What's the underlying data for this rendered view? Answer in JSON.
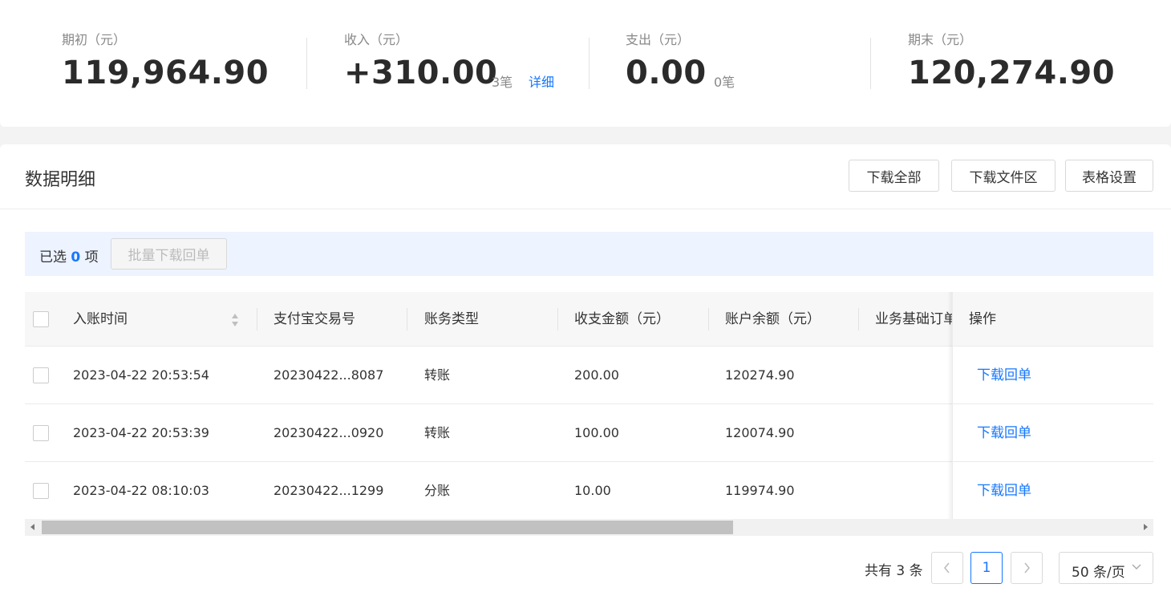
{
  "summary": {
    "opening": {
      "label": "期初（元）",
      "value": "119,964.90"
    },
    "income": {
      "label": "收入（元）",
      "value": "+310.00",
      "count": "3笔",
      "detail": "详细"
    },
    "expense": {
      "label": "支出（元）",
      "value": "0.00",
      "count": "0笔"
    },
    "closing": {
      "label": "期末（元）",
      "value": "120,274.90"
    }
  },
  "detail": {
    "title": "数据明细",
    "buttons": {
      "download_all": "下载全部",
      "download_files": "下载文件区",
      "table_settings": "表格设置"
    },
    "selection": {
      "prefix": "已选",
      "count": "0",
      "suffix": "项",
      "batch_button": "批量下载回单"
    }
  },
  "table": {
    "headers": {
      "time": "入账时间",
      "trade_no": "支付宝交易号",
      "type": "账务类型",
      "amount": "收支金额（元）",
      "balance": "账户余额（元）",
      "biz_order": "业务基础订单号",
      "ops": "操作"
    },
    "rows": [
      {
        "time": "2023-04-22 20:53:54",
        "trade_no": "20230422...8087",
        "type": "转账",
        "amount": "200.00",
        "balance": "120274.90",
        "op": "下载回单"
      },
      {
        "time": "2023-04-22 20:53:39",
        "trade_no": "20230422...0920",
        "type": "转账",
        "amount": "100.00",
        "balance": "120074.90",
        "op": "下载回单"
      },
      {
        "time": "2023-04-22 08:10:03",
        "trade_no": "20230422...1299",
        "type": "分账",
        "amount": "10.00",
        "balance": "119974.90",
        "op": "下载回单"
      }
    ]
  },
  "pagination": {
    "total": "共有 3 条",
    "current_page": "1",
    "page_size": "50 条/页"
  },
  "colors": {
    "accent": "#1677ff",
    "select_bar": "#edf3ff",
    "header_bg": "#f7f7f7"
  }
}
